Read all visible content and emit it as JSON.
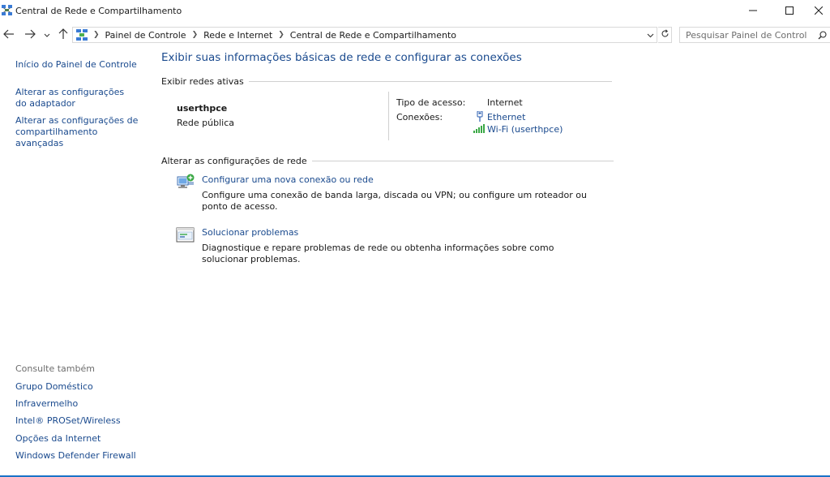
{
  "window": {
    "title": "Central de Rede e Compartilhamento"
  },
  "navigation": {
    "breadcrumbs": [
      "Painel de Controle",
      "Rede e Internet",
      "Central de Rede e Compartilhamento"
    ],
    "search_placeholder": "Pesquisar Painel de Controle"
  },
  "sidebar": {
    "links": [
      "Início do Painel de Controle",
      "Alterar as configurações do adaptador",
      "Alterar as configurações de compartilhamento avançadas"
    ],
    "see_also_title": "Consulte também",
    "see_also": [
      "Grupo Doméstico",
      "Infravermelho",
      "Intel® PROSet/Wireless",
      "Opções da Internet",
      "Windows Defender Firewall"
    ]
  },
  "main": {
    "title": "Exibir suas informações básicas de rede e configurar as conexões",
    "active_networks_header": "Exibir redes ativas",
    "network": {
      "name": "userthpce",
      "type": "Rede pública",
      "access_type_label": "Tipo de acesso:",
      "access_type_value": "Internet",
      "connections_label": "Conexões:",
      "connections": [
        "Ethernet",
        "Wi-Fi (userthpce)"
      ]
    },
    "change_settings_header": "Alterar as configurações de rede",
    "tasks": [
      {
        "title": "Configurar uma nova conexão ou rede",
        "description": "Configure uma conexão de banda larga, discada ou VPN; ou configure um roteador ou ponto de acesso."
      },
      {
        "title": "Solucionar problemas",
        "description": "Diagnostique e repare problemas de rede ou obtenha informações sobre como solucionar problemas."
      }
    ]
  },
  "colors": {
    "link": "#1a4a8e",
    "accent": "#1a73c8"
  }
}
